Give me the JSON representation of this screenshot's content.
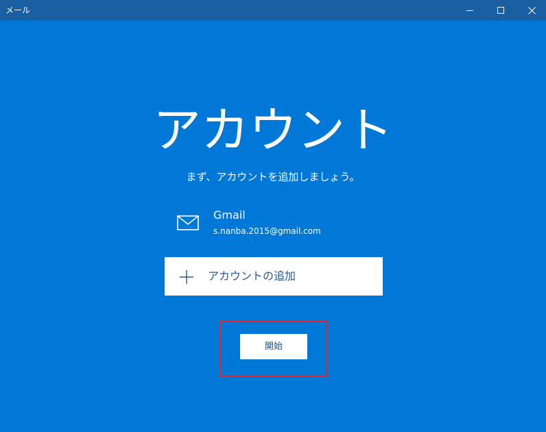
{
  "window": {
    "title": "メール",
    "controls": {
      "minimize_icon": "minimize-icon",
      "maximize_icon": "maximize-icon",
      "close_icon": "close-icon"
    }
  },
  "main": {
    "heading": "アカウント",
    "subtitle": "まず、アカウントを追加しましょう。",
    "account": {
      "icon": "mail-icon",
      "name": "Gmail",
      "email": "s.nanba.2015@gmail.com"
    },
    "add_account": {
      "icon": "plus-icon",
      "label": "アカウントの追加"
    },
    "start_button": "開始"
  },
  "colors": {
    "background": "#0078d7",
    "titlebar": "#1b5fa3",
    "highlight_border": "#e0262b",
    "button_text": "#2b5797"
  }
}
